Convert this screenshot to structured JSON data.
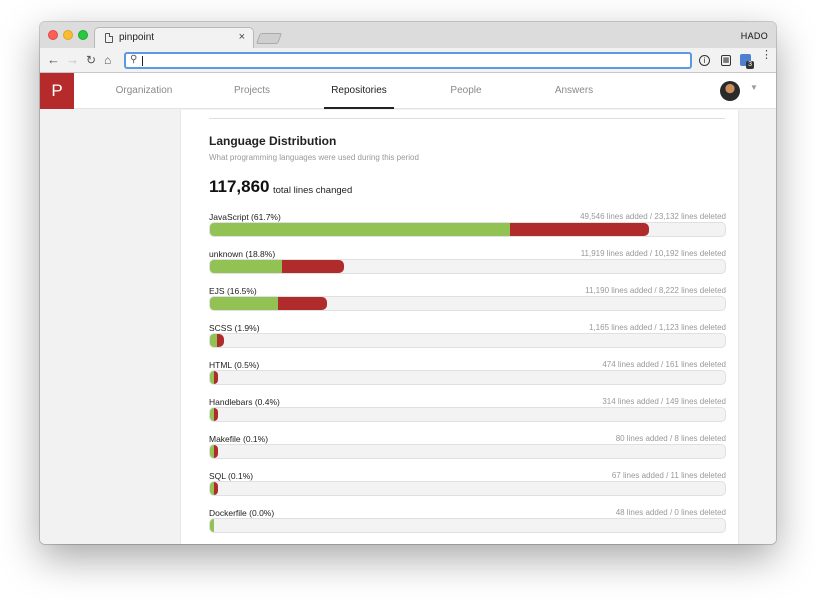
{
  "browser": {
    "tab_title": "pinpoint",
    "tab_close": "×",
    "profile_name": "HADO",
    "omnibox_value": "",
    "extension_badge": "3"
  },
  "app": {
    "logo": "P",
    "nav": [
      {
        "label": "Organization",
        "active": false
      },
      {
        "label": "Projects",
        "active": false
      },
      {
        "label": "Repositories",
        "active": true
      },
      {
        "label": "People",
        "active": false
      },
      {
        "label": "Answers",
        "active": false
      }
    ]
  },
  "section": {
    "title": "Language Distribution",
    "subtitle": "What programming languages were used during this period",
    "total_value": "117,860",
    "total_label": "total lines changed"
  },
  "colors": {
    "added": "#93c254",
    "deleted": "#b02c2c",
    "brand": "#b52a2a"
  },
  "languages": [
    {
      "name": "JavaScript (61.7%)",
      "stats": "49,546 lines added / 23,132 lines deleted",
      "added": 49546,
      "deleted": 23132
    },
    {
      "name": "unknown (18.8%)",
      "stats": "11,919 lines added / 10,192 lines deleted",
      "added": 11919,
      "deleted": 10192
    },
    {
      "name": "EJS (16.5%)",
      "stats": "11,190 lines added / 8,222 lines deleted",
      "added": 11190,
      "deleted": 8222
    },
    {
      "name": "SCSS (1.9%)",
      "stats": "1,165 lines added / 1,123 lines deleted",
      "added": 1165,
      "deleted": 1123
    },
    {
      "name": "HTML (0.5%)",
      "stats": "474 lines added / 161 lines deleted",
      "added": 474,
      "deleted": 161
    },
    {
      "name": "Handlebars (0.4%)",
      "stats": "314 lines added / 149 lines deleted",
      "added": 314,
      "deleted": 149
    },
    {
      "name": "Makefile (0.1%)",
      "stats": "80 lines added / 8 lines deleted",
      "added": 80,
      "deleted": 8
    },
    {
      "name": "SQL (0.1%)",
      "stats": "67 lines added / 11 lines deleted",
      "added": 67,
      "deleted": 11
    },
    {
      "name": "Dockerfile (0.0%)",
      "stats": "48 lines added / 0 lines deleted",
      "added": 48,
      "deleted": 0
    }
  ]
}
